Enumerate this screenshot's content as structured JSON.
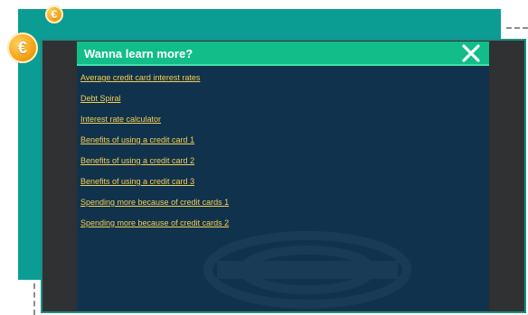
{
  "colors": {
    "teal_panel": "#0b9d94",
    "dark_frame": "#303132",
    "dialog_background": "#11324c",
    "header_background": "#12bd8a",
    "link_text": "#f2cf54",
    "coin": "#f5a317"
  },
  "icons": {
    "coin_symbol": "€",
    "close": "close-icon"
  },
  "dialog": {
    "title": "Wanna learn more?",
    "links": [
      {
        "label": "Average credit card interest rates"
      },
      {
        "label": "Debt Spiral"
      },
      {
        "label": "Interest rate calculator"
      },
      {
        "label": "Benefits of using a credit card 1"
      },
      {
        "label": "Benefits of using a credit card 2"
      },
      {
        "label": "Benefits of using a credit card 3"
      },
      {
        "label": "Spending more because of credit cards 1"
      },
      {
        "label": "Spending more because of credit cards 2"
      }
    ]
  }
}
